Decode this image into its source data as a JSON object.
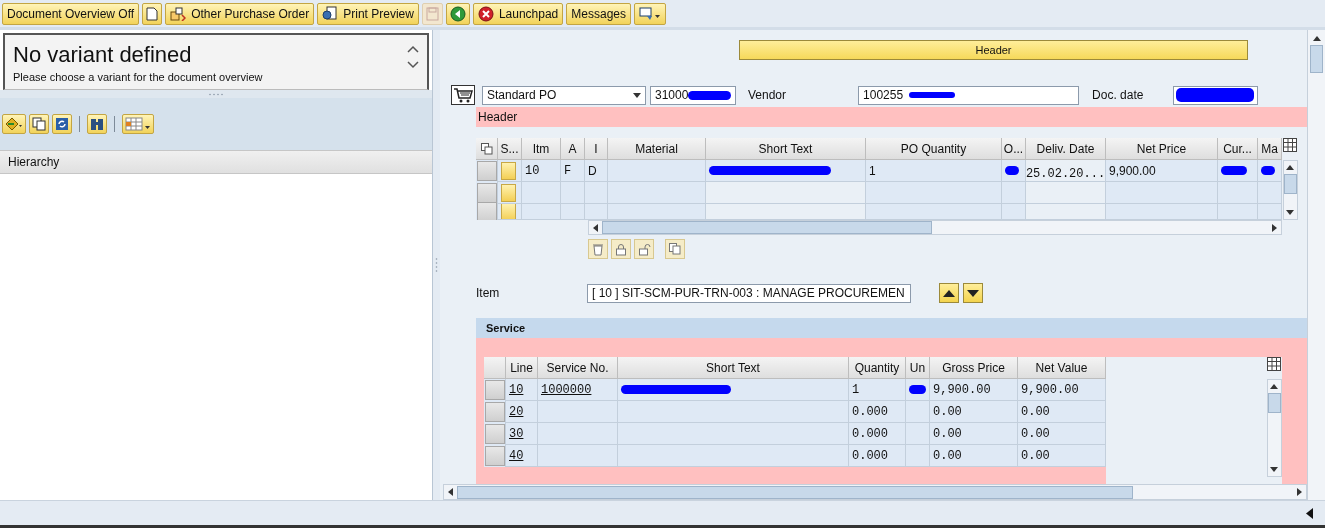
{
  "toolbar": {
    "buttons": [
      {
        "label": "Document Overview Off"
      },
      {
        "label": "Other Purchase Order"
      },
      {
        "label": "Print Preview"
      },
      {
        "label": "Launchpad"
      },
      {
        "label": "Messages"
      }
    ],
    "save_disabled": true
  },
  "variant_panel": {
    "title": "No variant defined",
    "hint": "Please choose a variant for the document overview"
  },
  "tree": {
    "column": "Hierarchy"
  },
  "header_toggle": "Header",
  "header_fields": {
    "doc_type": "Standard PO",
    "po_number": {
      "value": "31000",
      "redacted": true
    },
    "vendor_label": "Vendor",
    "vendor": {
      "value": "100255",
      "redacted": true
    },
    "date_label": "Doc. date",
    "doc_date": {
      "redacted": true
    }
  },
  "header_section": "Header",
  "items_table": {
    "columns": [
      "S...",
      "Itm",
      "A",
      "I",
      "Material",
      "Short Text",
      "PO Quantity",
      "O...",
      "Deliv. Date",
      "Net Price",
      "Cur...",
      "Ma"
    ],
    "rows": [
      {
        "cells": [
          {},
          {
            "text": "10"
          },
          {
            "text": "F"
          },
          {
            "text": "D"
          },
          {},
          {
            "redacted": true
          },
          {
            "text": "1"
          },
          {
            "redacted": true
          },
          {
            "text": "25.02.20..."
          },
          {
            "text": "9,900.00"
          },
          {
            "redacted": true
          },
          {
            "redacted": true
          }
        ]
      },
      {},
      {}
    ]
  },
  "item_selector": {
    "label": "Item",
    "value": "[ 10 ] SIT-SCM-PUR-TRN-003 : MANAGE PROCUREMEN"
  },
  "service_tab": "Service",
  "service_table": {
    "columns": [
      "Line",
      "Service No.",
      "Short Text",
      "Quantity",
      "Un",
      "Gross Price",
      "Net Value"
    ],
    "rows": [
      {
        "cells": [
          {
            "text": "10",
            "link": true
          },
          {
            "text": "1000000",
            "link": true
          },
          {
            "redacted": true
          },
          {
            "text": "1"
          },
          {
            "redacted": true
          },
          {
            "text": "9,900.00"
          },
          {
            "text": "9,900.00"
          }
        ]
      },
      {
        "cells": [
          {
            "text": "20",
            "link": true
          },
          {},
          {},
          {
            "text": "0.000"
          },
          {},
          {
            "text": "0.00"
          },
          {
            "text": "0.00"
          }
        ]
      },
      {
        "cells": [
          {
            "text": "30",
            "link": true
          },
          {},
          {},
          {
            "text": "0.000"
          },
          {},
          {
            "text": "0.00"
          },
          {
            "text": "0.00"
          }
        ]
      },
      {
        "cells": [
          {
            "text": "40",
            "link": true
          },
          {},
          {},
          {
            "text": "0.000"
          },
          {},
          {
            "text": "0.00"
          },
          {
            "text": "0.00"
          }
        ]
      }
    ]
  }
}
